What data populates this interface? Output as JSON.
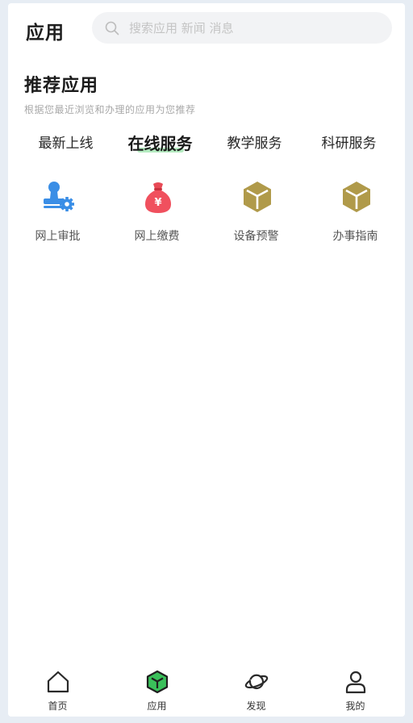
{
  "header": {
    "title": "应用",
    "search_placeholder": "搜索应用 新闻 消息",
    "search_value": ""
  },
  "section": {
    "title": "推荐应用",
    "subtitle": "根据您最近浏览和办理的应用为您推荐"
  },
  "tabs": [
    {
      "label": "最新上线",
      "active": false
    },
    {
      "label": "在线服务",
      "active": true
    },
    {
      "label": "教学服务",
      "active": false
    },
    {
      "label": "科研服务",
      "active": false
    }
  ],
  "apps": [
    {
      "label": "网上审批",
      "icon": "stamp-gear-icon"
    },
    {
      "label": "网上缴费",
      "icon": "money-bag-icon"
    },
    {
      "label": "设备预警",
      "icon": "cube-icon"
    },
    {
      "label": "办事指南",
      "icon": "cube-icon"
    }
  ],
  "bottom_nav": [
    {
      "label": "首页",
      "icon": "home-icon"
    },
    {
      "label": "应用",
      "icon": "app-cube-icon",
      "active": true
    },
    {
      "label": "发现",
      "icon": "planet-icon"
    },
    {
      "label": "我的",
      "icon": "user-icon"
    }
  ],
  "colors": {
    "accent_green": "#3ac05a",
    "tab_highlight": "#a6e6b4",
    "cube_gold": "#b09a4a",
    "stamp_blue": "#3a8ee6",
    "money_red": "#f0505e"
  }
}
